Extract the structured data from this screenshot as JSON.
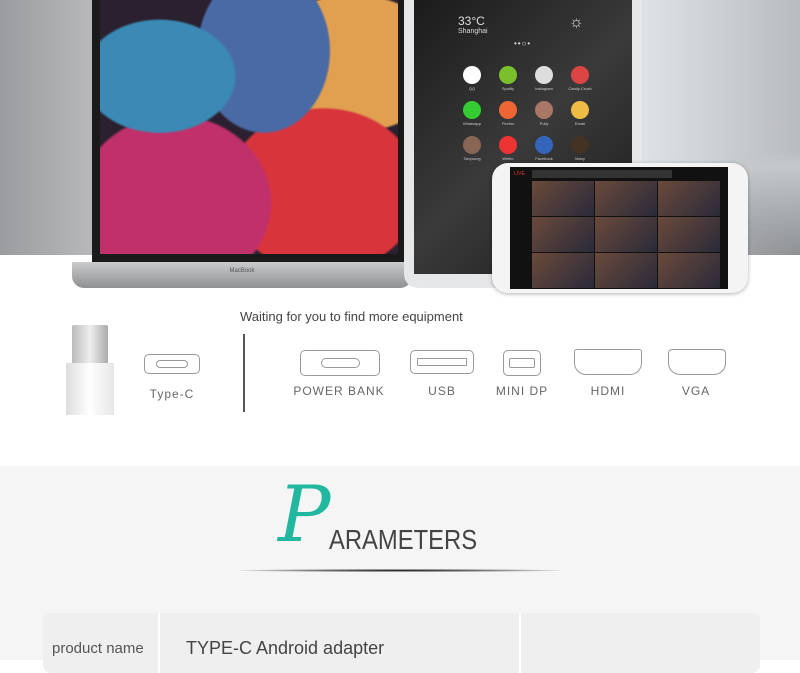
{
  "hero": {
    "laptop_label": "MacBook",
    "tablet": {
      "temperature": "33°C",
      "city": "Shanghai",
      "apps": [
        "QQ",
        "Spotify",
        "Instagram",
        "Candy Crush",
        "Whatsapp",
        "Firefox",
        "Polly",
        "Email",
        "Tanyoung",
        "Weibo",
        "Facebook",
        "Many"
      ]
    },
    "phone": {
      "live_label": "LIVE"
    }
  },
  "equipment": {
    "heading": "Waiting for you to find more equipment",
    "source": "Type-C",
    "targets": [
      "POWER BANK",
      "USB",
      "MINI DP",
      "HDMI",
      "VGA"
    ]
  },
  "parameters": {
    "title_initial": "P",
    "title_rest": "ARAMETERS",
    "accent_color": "#22b8a0",
    "rows": [
      {
        "key": "product name",
        "value": "TYPE-C Android adapter"
      }
    ]
  }
}
